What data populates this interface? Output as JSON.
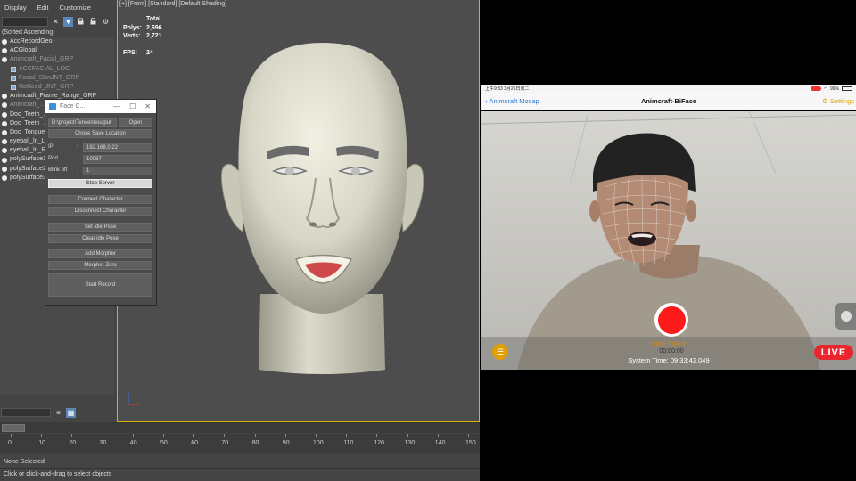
{
  "menu": {
    "display": "Display",
    "edit": "Edit",
    "customize": "Customize"
  },
  "scene_explorer": {
    "sort_label": "(Sorted Ascending)",
    "items": [
      {
        "label": "AccRecordGeo",
        "kind": "dot",
        "level": 0,
        "dim": false
      },
      {
        "label": "ACGlobal",
        "kind": "dot",
        "level": 0,
        "dim": false
      },
      {
        "label": "Animcraft_Facial_GRP",
        "kind": "dot",
        "level": 0,
        "dim": true
      },
      {
        "label": "ACCFACIAL_LOC",
        "kind": "sq",
        "level": 1,
        "dim": true
      },
      {
        "label": "Facial_SkinJNT_GRP",
        "kind": "sq",
        "level": 1,
        "dim": true
      },
      {
        "label": "NoNeed_JNT_GRP",
        "kind": "sq",
        "level": 1,
        "dim": true
      },
      {
        "label": "Animcraft_Frame_Range_GRP",
        "kind": "dot",
        "level": 0,
        "dim": false
      },
      {
        "label": "Animcraft_...",
        "kind": "dot",
        "level": 0,
        "dim": true
      },
      {
        "label": "Doc_Teeth_...",
        "kind": "dot",
        "level": 0,
        "dim": false
      },
      {
        "label": "Doc_Teeth_...",
        "kind": "dot",
        "level": 0,
        "dim": false
      },
      {
        "label": "Doc_Tongue",
        "kind": "dot",
        "level": 0,
        "dim": false
      },
      {
        "label": "eyeball_ln_L",
        "kind": "dot",
        "level": 0,
        "dim": false
      },
      {
        "label": "eyeball_ln_R",
        "kind": "dot",
        "level": 0,
        "dim": false
      },
      {
        "label": "polySurface1",
        "kind": "dot",
        "level": 0,
        "dim": false
      },
      {
        "label": "polySurface2",
        "kind": "dot",
        "level": 0,
        "dim": false
      },
      {
        "label": "polySurface3",
        "kind": "dot",
        "level": 0,
        "dim": false
      }
    ]
  },
  "viewport": {
    "label": "[+] [Front] [Standard] [Default Shading]",
    "stats": {
      "total_label": "Total",
      "polys_label": "Polys:",
      "polys_value": "2,696",
      "verts_label": "Verts:",
      "verts_value": "2,721",
      "fps_label": "FPS:",
      "fps_value": "24"
    }
  },
  "face_capture": {
    "title": "Face C...",
    "path": "D:\\project\\Tencent\\output",
    "open_label": "Open",
    "chose_save_label": "Chose Save Location",
    "ip_label": "IP",
    "ip_value": "192.168.0.22",
    "port_label": "Port",
    "port_value": "10087",
    "blink_label": "Blink off",
    "blink_value": "1",
    "colon": ":",
    "stop_server_label": "Stop Server",
    "connect_label": "Connect Character",
    "disconnect_label": "Disconnect Character",
    "set_idle_label": "Set idle Pose",
    "clear_idle_label": "Clear idle Pose",
    "add_morpher_label": "Add Morpher",
    "morpher_zero_label": "Morpher Zero",
    "start_record_label": "Start Record"
  },
  "timeline": {
    "ticks": [
      "0",
      "10",
      "20",
      "30",
      "40",
      "50",
      "60",
      "70",
      "80",
      "90",
      "100",
      "110",
      "120",
      "130",
      "140",
      "150"
    ]
  },
  "status": {
    "selection": "None Selected",
    "hint": "Click or click-and-drag to select objects"
  },
  "ipad": {
    "status_time": "上午9:33  3月26日周二",
    "battery": "99%",
    "nav_back": "Animcraft Mocap",
    "nav_title": "Animcraft-BiFace",
    "nav_settings": "Settings",
    "rec_time": "00:00:00",
    "take_label": "Slate Take 1",
    "system_time": "System Time: 09:33:42.049",
    "live_label": "LIVE"
  },
  "colors": {
    "accent_blue": "#2a74d6",
    "accent_orange": "#e0a000",
    "record_red": "#ff1a1a",
    "live_red": "#e8262e",
    "viewport_border": "#e0b000"
  }
}
